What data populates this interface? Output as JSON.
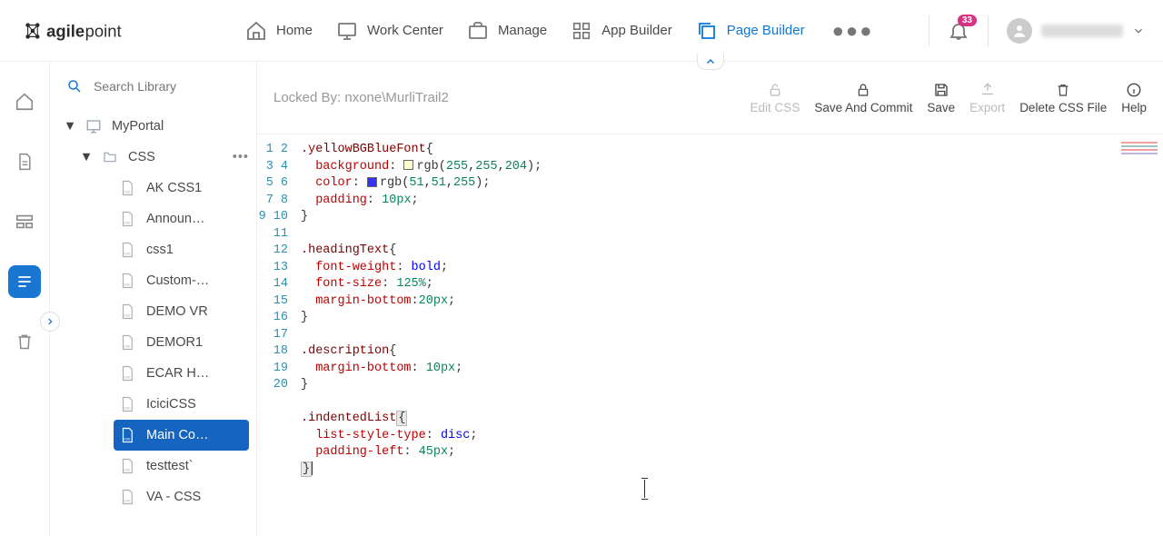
{
  "nav": {
    "home": "Home",
    "work_center": "Work Center",
    "manage": "Manage",
    "app_builder": "App Builder",
    "page_builder": "Page Builder",
    "notifications_count": "33"
  },
  "library": {
    "search_placeholder": "Search Library",
    "root": "MyPortal",
    "folder": "CSS",
    "files": [
      "AK CSS1",
      "Announ…",
      "css1",
      "Custom-…",
      "DEMO VR",
      "DEMOR1",
      "ECAR H…",
      "IciciCSS",
      "Main Co…",
      "testtest`",
      "VA - CSS"
    ],
    "selected_index": 8
  },
  "header": {
    "locked_by": "Locked By: nxone\\MurliTrail2",
    "actions": {
      "edit_css": "Edit CSS",
      "save_and_commit": "Save And Commit",
      "save": "Save",
      "export": "Export",
      "delete_css_file": "Delete CSS File",
      "help": "Help"
    }
  },
  "code": {
    "line_count": 20,
    "lines": {
      "l1_sel": ".yellowBGBlueFont",
      "l2_prop": "background",
      "l2_rgb": "rgb",
      "l2_r": "255",
      "l2_g": "255",
      "l2_b": "204",
      "l3_prop": "color",
      "l3_rgb": "rgb",
      "l3_r": "51",
      "l3_g": "51",
      "l3_b": "255",
      "l4_prop": "padding",
      "l4_val": "10px",
      "l7_sel": ".headingText",
      "l8_prop": "font-weight",
      "l8_val": "bold",
      "l9_prop": "font-size",
      "l9_val": "125%",
      "l10_prop": "margin-bottom",
      "l10_val": "20px",
      "l13_sel": ".description",
      "l14_prop": "margin-bottom",
      "l14_val": "10px",
      "l17_sel": ".indentedList",
      "l18_prop": "list-style-type",
      "l18_val": "disc",
      "l19_prop": "padding-left",
      "l19_val": "45px"
    }
  }
}
